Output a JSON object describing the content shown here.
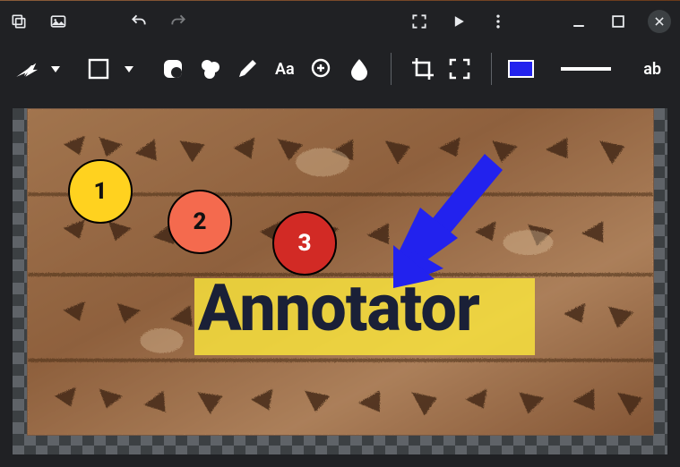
{
  "annotations": {
    "marker1": "1",
    "marker2": "2",
    "marker3": "3",
    "text": "Annotator"
  },
  "toolbar": {
    "textToolLabel": "Aa",
    "abLabel": "ab",
    "fillColor": "#2222ee"
  }
}
